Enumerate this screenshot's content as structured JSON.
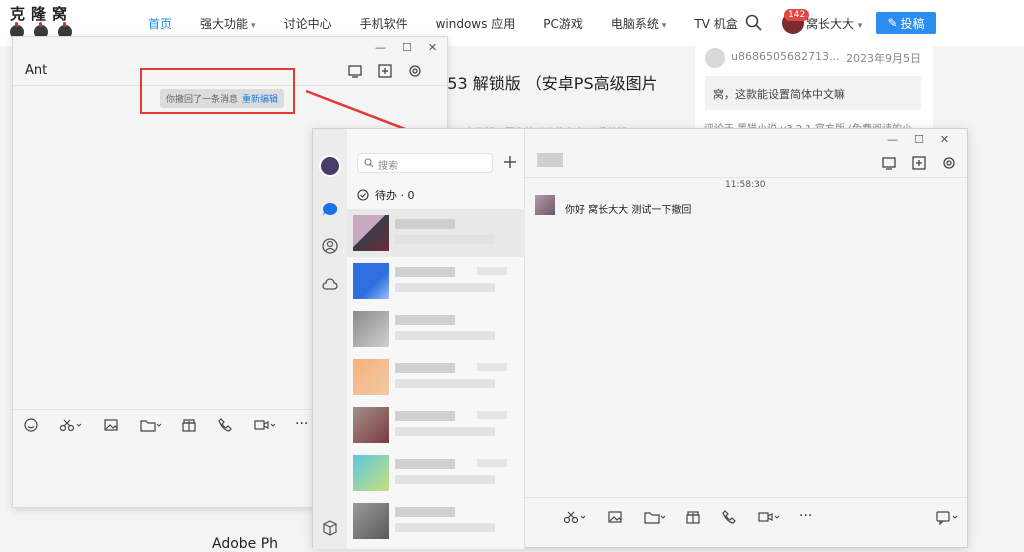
{
  "site": {
    "logo_text": "克隆窝",
    "nav": [
      {
        "label": "首页",
        "active": true,
        "caret": false
      },
      {
        "label": "强大功能",
        "active": false,
        "caret": true
      },
      {
        "label": "讨论中心",
        "active": false,
        "caret": false
      },
      {
        "label": "手机软件",
        "active": false,
        "caret": false
      },
      {
        "label": "windows 应用",
        "active": false,
        "caret": false
      },
      {
        "label": "PC游戏",
        "active": false,
        "caret": false
      },
      {
        "label": "电脑系统",
        "active": false,
        "caret": true
      },
      {
        "label": "TV 机盒",
        "active": false,
        "caret": false
      }
    ],
    "badge_count": "142",
    "user_name": "窝长大大",
    "post_button": "投稿",
    "article_title": "5.53 解锁版 （安卓PS高级图片",
    "article_sub": "安卓PS高级版，图像处理软件安卓PS手机版",
    "article_bottom": "Adobe Ph",
    "comment": {
      "user": "u8686505682713...",
      "date": "2023年9月5日",
      "text": "窝，这款能设置简体中文嘛",
      "footer": "评论于 黑猫小说 v3.2.1 官方版 (免费阅读的小..."
    }
  },
  "left_window": {
    "title": "Ant",
    "recall_text": "你撤回了一条消息",
    "reedit_link": "重新编辑"
  },
  "right_window": {
    "search_placeholder": "搜索",
    "todo_label": "待办 · 0",
    "timestamp": "11:58:30",
    "message": "你好 窝长大大 测试一下撤回"
  },
  "colors": {
    "accent": "#1a8ee6",
    "annotation": "#e53935",
    "badge": "#e64545"
  }
}
